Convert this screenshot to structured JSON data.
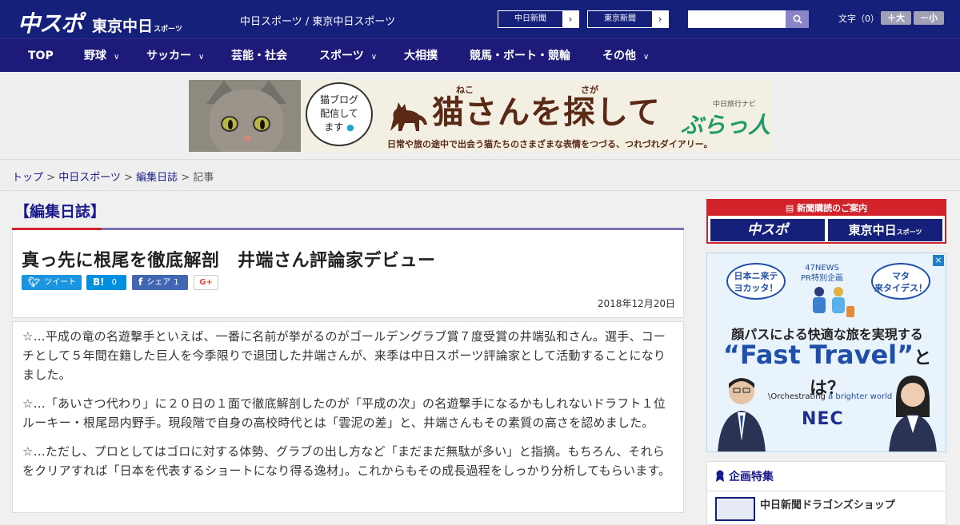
{
  "header": {
    "logo_main": "中スポ",
    "logo_sub": "東京中日",
    "logo_sub_small": "スポーツ",
    "site_names": "中日スポーツ / 東京中日スポーツ",
    "site_links": [
      "中日新聞",
      "東京新聞"
    ],
    "font_size_label": "文字（0）",
    "font_larger": "＋大",
    "font_smaller": "－小"
  },
  "nav": {
    "items": [
      {
        "label": "TOP",
        "dropdown": false
      },
      {
        "label": "野球",
        "dropdown": true
      },
      {
        "label": "サッカー",
        "dropdown": true
      },
      {
        "label": "芸能・社会",
        "dropdown": false
      },
      {
        "label": "スポーツ",
        "dropdown": true
      },
      {
        "label": "大相撲",
        "dropdown": false
      },
      {
        "label": "競馬・ボート・競輪",
        "dropdown": false
      },
      {
        "label": "その他",
        "dropdown": true
      }
    ]
  },
  "banner": {
    "bubble_lines": [
      "猫ブログ",
      "配信して",
      "ます"
    ],
    "title": "猫さんを探して",
    "ruby_neko": "ねこ",
    "ruby_saga": "さが",
    "subtitle": "日常や旅の途中で出会う猫たちのさまざまな表情をつづる、つれづれダイアリー。",
    "brand_small": "中日旅行ナビ",
    "brand": "ぶらっ人"
  },
  "breadcrumb": {
    "items": [
      "トップ",
      "中日スポーツ",
      "編集日誌"
    ],
    "current": "記事"
  },
  "article": {
    "section": "【編集日誌】",
    "title": "真っ先に根尾を徹底解剖　井端さん評論家デビュー",
    "share": {
      "tweet": "ツイート",
      "hatena_count": "0",
      "facebook": "シェア",
      "facebook_count": "1",
      "gplus": "G+"
    },
    "date": "2018年12月20日",
    "paragraphs": [
      "☆…平成の竜の名遊撃手といえば、一番に名前が挙がるのがゴールデングラブ賞７度受賞の井端弘和さん。選手、コーチとして５年間在籍した巨人を今季限りで退団した井端さんが、来季は中日スポーツ評論家として活動することになりました。",
      "☆…「あいさつ代わり」に２０日の１面で徹底解剖したのが「平成の次」の名遊撃手になるかもしれないドラフト１位ルーキー・根尾昂内野手。現段階で自身の高校時代とは「雲泥の差」と、井端さんもその素質の高さを認めました。",
      "☆…ただし、プロとしてはゴロに対する体勢、グラブの出し方など「まだまだ無駄が多い」と指摘。もちろん、それらをクリアすれば「日本を代表するショートになり得る逸材」。これからもその成長過程をしっかり分析してもらいます。"
    ]
  },
  "sidebar": {
    "subscribe_head": "新聞購読のご案内",
    "subscribe_left": "中スポ",
    "subscribe_right": "東京中日",
    "subscribe_right_small": "スポーツ",
    "ad": {
      "bubble_left": [
        "日本ニ来テ",
        "ヨカッタ！"
      ],
      "org": "47NEWS",
      "org_sub": "PR特別企画",
      "bubble_right": [
        "マタ",
        "来タイデス！"
      ],
      "line1": "顔パスによる快適な旅を実現する",
      "line2_main": "“Fast Travel”",
      "line2_tail": "とは？",
      "tagline_prefix": "\\Orchestrating",
      "tagline_rest": "a brighter world",
      "brand": "NEC"
    },
    "feature_head": "企画特集",
    "feature_item": "中日新聞ドラゴンズショップ"
  },
  "colors": {
    "header_bg": "#14207a",
    "nav_bg": "#1e1a7a",
    "accent_red": "#d2232a",
    "link": "#1a1a8c"
  }
}
